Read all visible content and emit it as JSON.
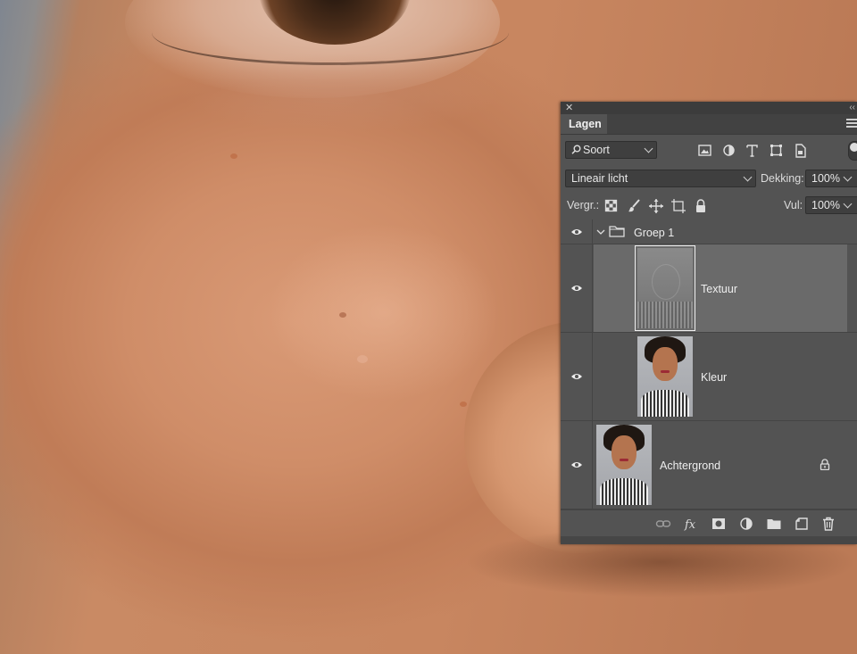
{
  "panel": {
    "tab_label": "Lagen",
    "filter": {
      "label": "Soort"
    },
    "blend_mode": "Lineair licht",
    "opacity_label": "Dekking:",
    "opacity_value": "100%",
    "lock_label": "Vergr.:",
    "fill_label": "Vul:",
    "fill_value": "100%",
    "layers": [
      {
        "name": "Groep 1",
        "type": "group",
        "visible": true
      },
      {
        "name": "Textuur",
        "type": "layer",
        "visible": true,
        "selected": true
      },
      {
        "name": "Kleur",
        "type": "layer",
        "visible": true
      },
      {
        "name": "Achtergrond",
        "type": "background",
        "visible": true,
        "locked": true
      }
    ]
  },
  "colors": {
    "panel_bg": "#535353",
    "selected_row": "#6a6a6a",
    "field_bg": "#3f3f3f"
  },
  "icons": [
    "close-icon",
    "panel-menu-icon",
    "search-icon",
    "image-filter-icon",
    "adjustment-filter-icon",
    "type-filter-icon",
    "shape-filter-icon",
    "smartobject-filter-icon",
    "lock-transparent-icon",
    "lock-pixels-icon",
    "lock-position-icon",
    "lock-artboard-icon",
    "lock-all-icon",
    "eye-icon",
    "folder-icon",
    "link-icon",
    "fx-icon",
    "mask-icon",
    "adjustment-icon",
    "new-group-icon",
    "new-layer-icon",
    "trash-icon"
  ]
}
